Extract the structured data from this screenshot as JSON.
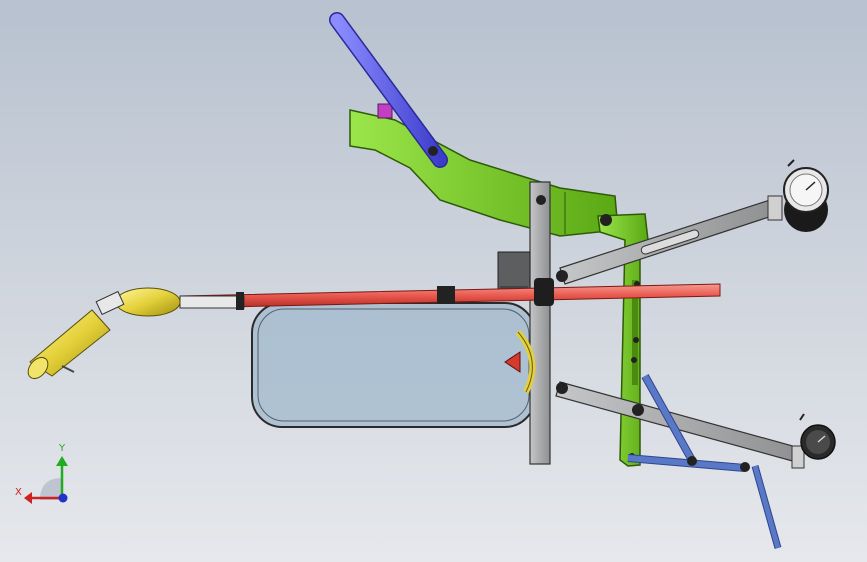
{
  "viewport": {
    "background_top": "#b7c1cf",
    "background_bottom": "#e6e8ec"
  },
  "triad": {
    "x_label": "X",
    "y_label": "Y",
    "x_color": "#cc2222",
    "y_color": "#22aa22",
    "z_color": "#2233cc"
  },
  "model_colors": {
    "frame_green": "#7ed321",
    "rod_red": "#e8574d",
    "handle_blue": "#5c5ce6",
    "link_blue": "#5a78c8",
    "frame_grey": "#a9aaab",
    "tank_blue": "#9fb8cc",
    "nozzle_yellow": "#e4d13a",
    "gauge_face": "#eeeeee"
  }
}
